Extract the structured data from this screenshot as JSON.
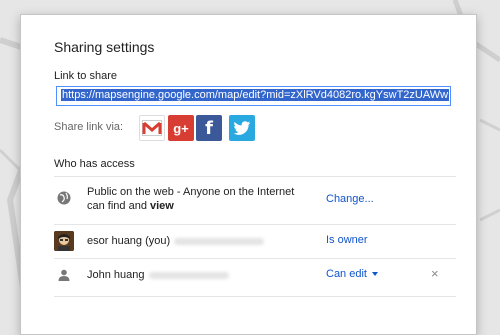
{
  "dialog": {
    "title": "Sharing settings",
    "link_section_label": "Link to share",
    "link_value": "https://mapsengine.google.com/map/edit?mid=zXlRVd4082ro.kgYswT2zUAWw",
    "share_via_label": "Share link via:",
    "share_targets": [
      {
        "name": "gmail-icon",
        "label": "M"
      },
      {
        "name": "google-plus-icon",
        "label": "g+"
      },
      {
        "name": "facebook-icon",
        "label": "f"
      },
      {
        "name": "twitter-icon",
        "label": "twitter"
      }
    ],
    "access_section_label": "Who has access",
    "access_rows": [
      {
        "icon": "globe-icon",
        "text_line1": "Public on the web - Anyone on the Internet",
        "text_line2_prefix": "can find and ",
        "text_line2_bold": "view",
        "action": "Change..."
      },
      {
        "icon": "avatar",
        "name": "esor huang (you)",
        "action": "Is owner"
      },
      {
        "icon": "person-icon",
        "name": "John huang",
        "action": "Can edit",
        "remove_label": "×"
      }
    ]
  },
  "colors": {
    "link_blue": "#1155cc",
    "selection": "#3366cc",
    "input_focus_border": "#4d90fe"
  }
}
